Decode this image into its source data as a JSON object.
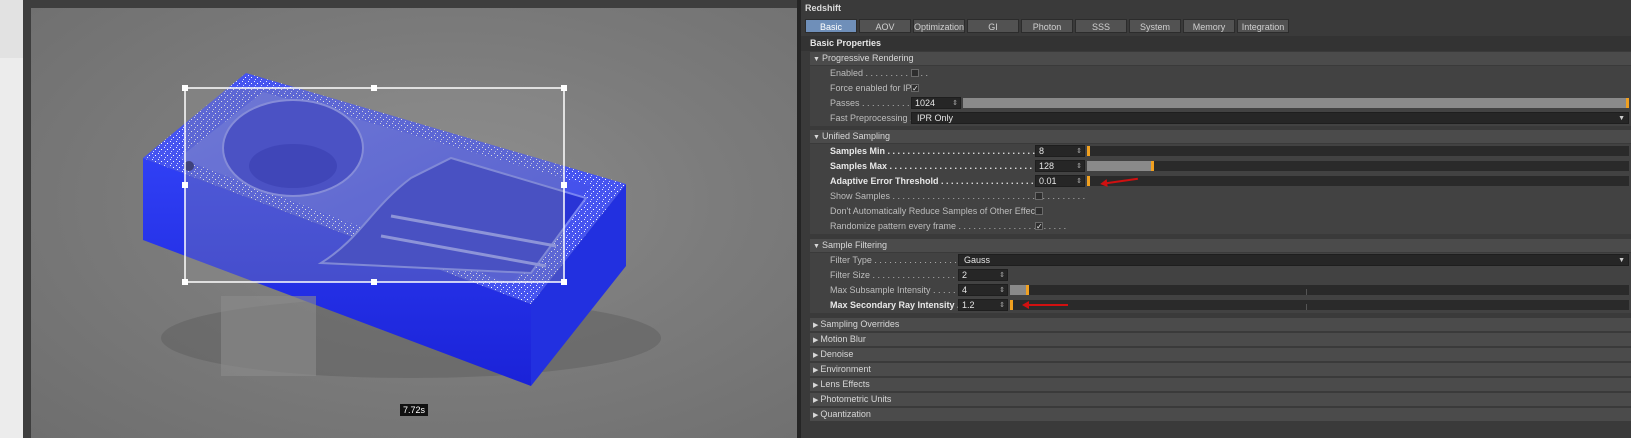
{
  "viewport": {
    "render_time": "7.72s"
  },
  "panel": {
    "title": "Redshift",
    "tabs": [
      "Basic",
      "AOV",
      "Optimization",
      "GI",
      "Photon",
      "SSS",
      "System",
      "Memory",
      "Integration"
    ],
    "section_title": "Basic Properties",
    "progressive": {
      "title": "Progressive Rendering",
      "enabled_label": "Enabled . . . . . . . . . . . . .",
      "force_ipr_label": "Force enabled for IPR",
      "passes_label": "Passes . . . . . . . . . . . . .",
      "passes_value": "1024",
      "fast_pre_label": "Fast Preprocessing . .",
      "fast_pre_value": "IPR Only"
    },
    "unified": {
      "title": "Unified Sampling",
      "samples_min_label": "Samples Min . . . . . . . . . . . . . . . . . . . . . . . . . . . . . . . . . . . . .",
      "samples_min_value": "8",
      "samples_max_label": "Samples Max . . . . . . . . . . . . . . . . . . . . . . . . . . . . . . . . . . . .",
      "samples_max_value": "128",
      "aet_label": "Adaptive Error Threshold . . . . . . . . . . . . . . . . . . . . . . . . .",
      "aet_value": "0.01",
      "show_samples_label": "Show Samples . . . . . . . . . . . . . . . . . . . . . . . . . . . . . . . . . . . . . . .",
      "dont_reduce_label": "Don't Automatically Reduce Samples of Other Effects",
      "randomize_label": "Randomize pattern every frame . . . . . . . . . . . . . . . . . . . . . ."
    },
    "filtering": {
      "title": "Sample Filtering",
      "filter_type_label": "Filter Type . . . . . . . . . . . . . . . . . . . . . . . .",
      "filter_type_value": "Gauss",
      "filter_size_label": "Filter Size . . . . . . . . . . . . . . . . . . . . . . . .",
      "filter_size_value": "2",
      "max_sub_label": "Max Subsample Intensity . . . . . . . . . . . . .",
      "max_sub_value": "4",
      "max_sec_label": "Max Secondary Ray Intensity . . . . . . . . .",
      "max_sec_value": "1.2"
    },
    "collapsed": [
      "Sampling Overrides",
      "Motion Blur",
      "Denoise",
      "Environment",
      "Lens Effects",
      "Photometric Units",
      "Quantization"
    ]
  },
  "colors": {
    "accent_tab": "#6f8fb9",
    "slider_handle": "#f0a020",
    "annotation_arrow": "#d01010",
    "object_blue": "#2030ff"
  },
  "icons": {
    "expanded": "triangle-down-icon",
    "collapsed": "triangle-right-icon",
    "checkmark": "checkmark-icon"
  },
  "state": {
    "enabled_checked": false,
    "force_ipr_checked": true,
    "show_samples_checked": false,
    "dont_reduce_checked": false,
    "randomize_checked": true,
    "passes_fraction": 1.0,
    "samples_min_fraction": 0.0,
    "samples_max_fraction": 0.12,
    "aet_fraction": 0.0,
    "max_sub_fraction": 0.05,
    "max_sec_fraction": 0.0
  }
}
